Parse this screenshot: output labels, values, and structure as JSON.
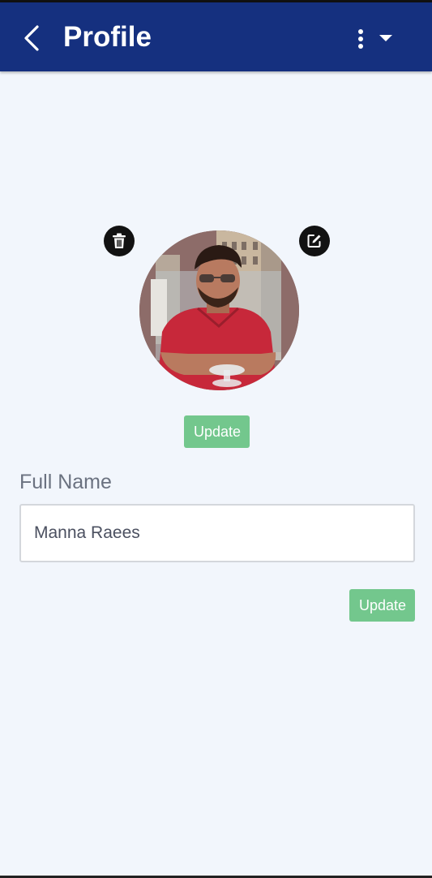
{
  "appbar": {
    "title": "Profile",
    "back_icon": "chevron-left-icon",
    "more_icon": "more-vertical-icon",
    "dropdown_icon": "caret-down-icon",
    "background": "#15307f"
  },
  "profile_photo": {
    "delete_icon": "trash-icon",
    "edit_icon": "edit-square-icon",
    "update_label": "Update"
  },
  "full_name": {
    "label": "Full Name",
    "value": "Manna Raees",
    "update_label": "Update"
  },
  "colors": {
    "accent_green": "#73c78d",
    "page_background": "#f2f6fc"
  }
}
